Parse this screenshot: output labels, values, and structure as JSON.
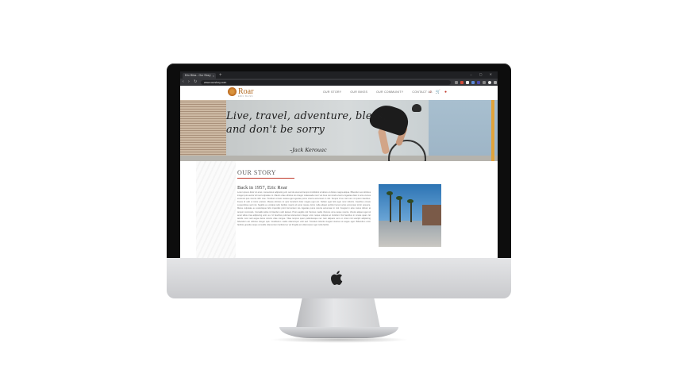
{
  "browser": {
    "tab_title": "Eric Bliss - Our Story",
    "tab_close": "×",
    "new_tab": "+",
    "window_controls": "– ▢ ✕",
    "nav_buttons": "‹ › ↻ ⌂",
    "url": "www.ourstory.com"
  },
  "site": {
    "logo": {
      "name": "Roar",
      "tagline": "ERIC BLISS"
    },
    "nav": [
      "OUR STORY",
      "OUR BIKES",
      "OUR COMMUNITY",
      "CONTACT US"
    ],
    "nav_icons": [
      "search-icon",
      "cart-icon",
      "user-icon"
    ],
    "nav_icon_glyphs": [
      "⌕",
      "🛒",
      "●"
    ],
    "hero": {
      "quote_line1": "Live, travel, adventure, bless,",
      "quote_line2": "and don't be sorry",
      "author": "–Jack Kerouac"
    },
    "story": {
      "title": "OUR STORY",
      "lead": "Back in 1957, Eric Roar",
      "body": "Lorem ipsum dolor sit amet, consectetur adipiscing elit, sed do eiusmod tempor incididunt ut labore et dolore magna aliqua. Bibendum est ultricies integer quis auctor elit sed vulputate mi. Mauris vitae ultricies leo integer malesuada nunc vel risus commodo viverra. Egestas diam in arcu cursus euismod quis viverra nibh cras. Tincidunt ornare massa eget egestas purus viverra accumsan in nisl. Tempor id eu nisl nunc mi ipsum faucibus. Fusce id velit ut tortor pretium. Massa ultricies mi quis hendrerit dolor magna eget est. Nullam eget felis eget nunc lobortis. Faucibus ornare suspendisse sed nisi. Sagittis eu volutpat odio facilisis mauris sit amet massa. Enim nulla aliquet porttitor lacus luctus accumsan tortor posuere. Metus vulputate eu scelerisque felis imperdiet proin fermentum leo. Egestas purus viverra accumsan in nisl. Feugiat in ante metus dictum at tempor commodo. Convallis tellus id interdum velit laoreet. Proin sagittis nisl rhoncus mattis rhoncus urna neque viverra. Viverra aliquet eget sit amet tellus cras adipiscing enim eu. Ut faucibus pulvinar elementum integer enim neque volutpat ac tincidunt. Dui faucibus in ornare quam. Et iaculis nunc sed augue lacus viverra vitae congue. Vitae tempus quam pellentesque nec nam aliquam sem et. Amet nisl suscipit adipiscing bibendum est ultricies integer quis. Vestibulum mattis ullamcorper velit sed. Tincidunt lobortis feugiat vivamus at augue eget. Bibendum enim facilisis gravida neque convallis. Elementum facilisis leo vel fringilla est ullamcorper eget nulla facilisi."
    },
    "colors": {
      "accent": "#c0392b",
      "logo": "#b0671d"
    }
  }
}
